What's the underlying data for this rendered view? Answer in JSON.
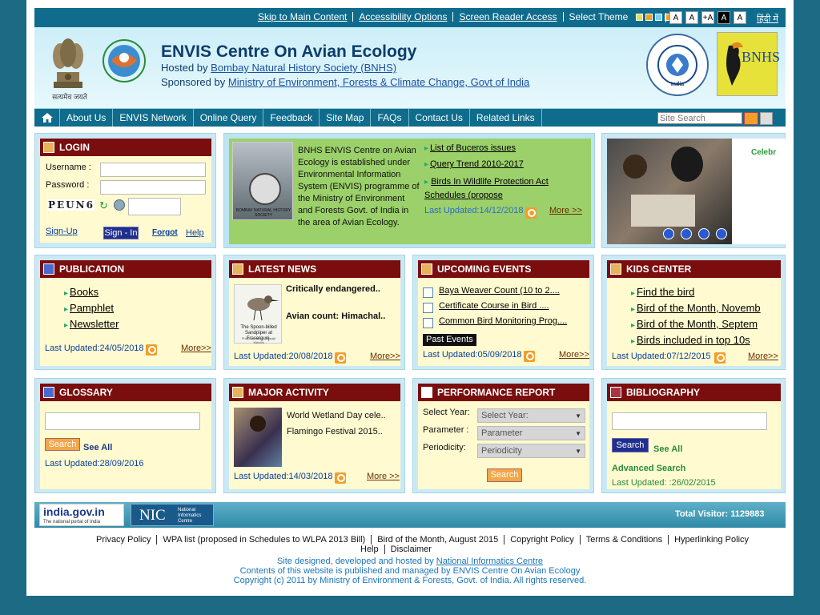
{
  "topbar": {
    "links": [
      "Skip to Main Content",
      "Accessibility Options",
      "Screen Reader Access",
      "Select Theme"
    ],
    "theme_colors": [
      "#e0e050",
      "#f0a020",
      "#7ad0f0",
      "#f0a020",
      "#6fc0e0"
    ],
    "font_buttons": [
      "A",
      "A",
      "+A",
      "A",
      "A"
    ],
    "hindi_label": "हिंदी में"
  },
  "header": {
    "title": "ENVIS Centre On Avian Ecology",
    "hosted_by_label": "Hosted by",
    "hosted_by_link": "Bombay Natural History Society (BNHS)",
    "sponsored_by_label": "Sponsored by",
    "sponsored_by_link": "Ministry of Environment, Forests & Climate Change, Govt of India",
    "emblem_caption": "सत्यमेव जयते",
    "bnhs_logo_text": "BNHS",
    "eis_logo_text": "Environmental Information System",
    "eis_logo_country": "India"
  },
  "nav": {
    "items": [
      "About Us",
      "ENVIS Network",
      "Online Query",
      "Feedback",
      "Site Map",
      "FAQs",
      "Contact Us",
      "Related Links"
    ],
    "search_placeholder": "Site Search"
  },
  "login": {
    "title": "LOGIN",
    "username_label": "Username :",
    "password_label": "Password :",
    "captcha_text": "PEUN6",
    "signup_label": "Sign-Up",
    "signin_label": "Sign - In",
    "forgot_label": "Forgot",
    "help_label": "Help"
  },
  "about": {
    "description": "BNHS ENVIS Centre on Avian Ecology is established under Environmental Information System (ENVIS) programme of the Ministry of Environment and Forests Govt. of India in the area of Avian Ecology.",
    "image_caption": "BOMBAY NATURAL HISTORY SOCIETY",
    "links": [
      "List of Buceros issues",
      "Query Trend 2010-2017",
      "Birds In Wildlife Protection Act Schedules (propose"
    ],
    "updated": "Last Updated:14/12/2018",
    "more": "More >>"
  },
  "slideshow": {
    "caption": "Celebr"
  },
  "publication": {
    "title": "PUBLICATION",
    "items": [
      "Books",
      "Pamphlet",
      "Newsletter"
    ],
    "updated": "Last Updated:24/05/2018",
    "more": "More>>"
  },
  "news": {
    "title": "LATEST NEWS",
    "items": [
      "Critically endangered..",
      "Avian count: Himachal.."
    ],
    "image_caption": "The Spoon-billed Sandpiper at Frasergunj.",
    "image_credit": "Photo courtesy: Biswajit Mandal",
    "updated": "Last Updated:20/08/2018",
    "more": "More>>"
  },
  "events": {
    "title": "UPCOMING EVENTS",
    "items": [
      "Baya Weaver Count (10 to 2....",
      "Certificate Course in Bird ....",
      "Common Bird Monitoring Prog...."
    ],
    "past_label": "Past Events",
    "updated": "Last Updated:05/09/2018",
    "more": "More>>"
  },
  "kids": {
    "title": "KIDS CENTER",
    "items": [
      "Find the bird",
      "Bird of the Month, Novemb",
      "Bird of the Month, Septem",
      "Birds included in top 10s"
    ],
    "updated": "Last Updated:07/12/2015",
    "more": "More>>"
  },
  "glossary": {
    "title": "GLOSSARY",
    "search_label": "Search",
    "see_all": "See All",
    "updated": "Last Updated:28/09/2016"
  },
  "activity": {
    "title": "MAJOR ACTIVITY",
    "items": [
      "World Wetland Day cele..",
      "Flamingo Festival 2015.."
    ],
    "updated": "Last Updated:14/03/2018",
    "more": "More >>"
  },
  "performance": {
    "title": "PERFORMANCE REPORT",
    "year_label": "Select Year:",
    "year_value": "Select Year:",
    "parameter_label": "Parameter :",
    "parameter_value": "Parameter",
    "periodicity_label": "Periodicity:",
    "periodicity_value": "Periodicity",
    "search_label": "Search"
  },
  "bibliography": {
    "title": "BIBLIOGRAPHY",
    "search_label": "Search",
    "see_all": "See All",
    "advanced": "Advanced Search",
    "updated": "Last Updated: :26/02/2015"
  },
  "footer": {
    "india_gov": "india.gov.in",
    "india_gov_sub": "The national portal of India",
    "nic": "NIC",
    "nic_sub1": "National",
    "nic_sub2": "Informatics",
    "nic_sub3": "Centre",
    "visitors": "Total Visitor: 1129883",
    "links": [
      "Privacy Policy",
      "WPA list (proposed in Schedules to WLPA 2013 Bill)",
      "Bird of the Month, August 2015",
      "Copyright Policy",
      "Terms & Conditions",
      "Hyperlinking Policy",
      "Help",
      "Disclaimer"
    ],
    "credit1_label": "Site designed, developed and hosted by",
    "credit1_link": "National Informatics Centre",
    "credit2": "Contents of this website is published and managed by ENVIS Centre On Avian Ecology",
    "credit3": "Copyright (c) 2011 by Ministry of Environment & Forests, Govt. of India. All rights reserved."
  }
}
